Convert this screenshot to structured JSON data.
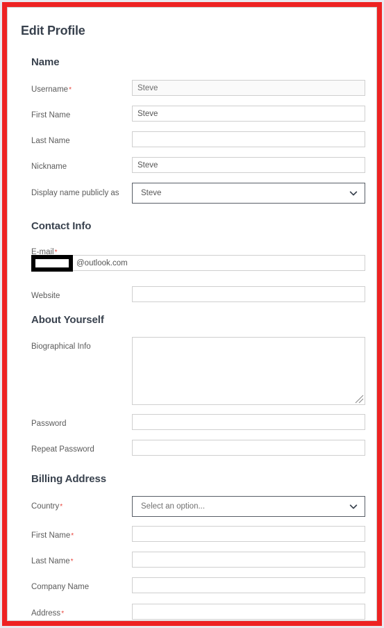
{
  "frame": {
    "highlight_color": "#ee2222",
    "card_background": "#ffffff",
    "page_background": "#e8e8ef"
  },
  "page": {
    "title": "Edit Profile"
  },
  "sections": [
    {
      "heading": "Name",
      "fields": [
        {
          "label": "Username",
          "required": true,
          "type": "text",
          "value": "Steve",
          "readonly": true
        },
        {
          "label": "First Name",
          "required": false,
          "type": "text",
          "value": "Steve",
          "readonly": false
        },
        {
          "label": "Last Name",
          "required": false,
          "type": "text",
          "value": "",
          "readonly": false
        },
        {
          "label": "Nickname",
          "required": false,
          "type": "text",
          "value": "Steve",
          "readonly": false
        },
        {
          "label": "Display name publicly as",
          "required": false,
          "type": "select",
          "value": "Steve"
        }
      ]
    },
    {
      "heading": "Contact Info",
      "fields": [
        {
          "label": "E-mail",
          "required": true,
          "type": "email-redacted",
          "value": "@outlook.com"
        },
        {
          "label": "Website",
          "required": false,
          "type": "text",
          "value": "",
          "readonly": false
        }
      ]
    },
    {
      "heading": "About Yourself",
      "fields": [
        {
          "label": "Biographical Info",
          "required": false,
          "type": "textarea",
          "value": ""
        },
        {
          "label": "Password",
          "required": false,
          "type": "text",
          "value": "",
          "readonly": false
        },
        {
          "label": "Repeat Password",
          "required": false,
          "type": "text",
          "value": "",
          "readonly": false
        }
      ]
    },
    {
      "heading": "Billing Address",
      "fields": [
        {
          "label": "Country",
          "required": true,
          "type": "select",
          "value": "Select an option...",
          "is_placeholder": true
        },
        {
          "label": "First Name",
          "required": true,
          "type": "text",
          "value": "",
          "readonly": false
        },
        {
          "label": "Last Name",
          "required": true,
          "type": "text",
          "value": "",
          "readonly": false
        },
        {
          "label": "Company Name",
          "required": false,
          "type": "text",
          "value": "",
          "readonly": false
        },
        {
          "label": "Address",
          "required": true,
          "type": "text",
          "value": "",
          "readonly": false
        }
      ]
    }
  ],
  "icons": {
    "chevron_down": "chevron-down-icon",
    "resize_grip": "resize-grip-icon"
  },
  "colors": {
    "heading": "#39424e",
    "label": "#5b5b5b",
    "required_asterisk": "#e8453c",
    "input_border": "#cfcfcf",
    "select_border": "#575d66",
    "readonly_background": "#fafafa"
  }
}
